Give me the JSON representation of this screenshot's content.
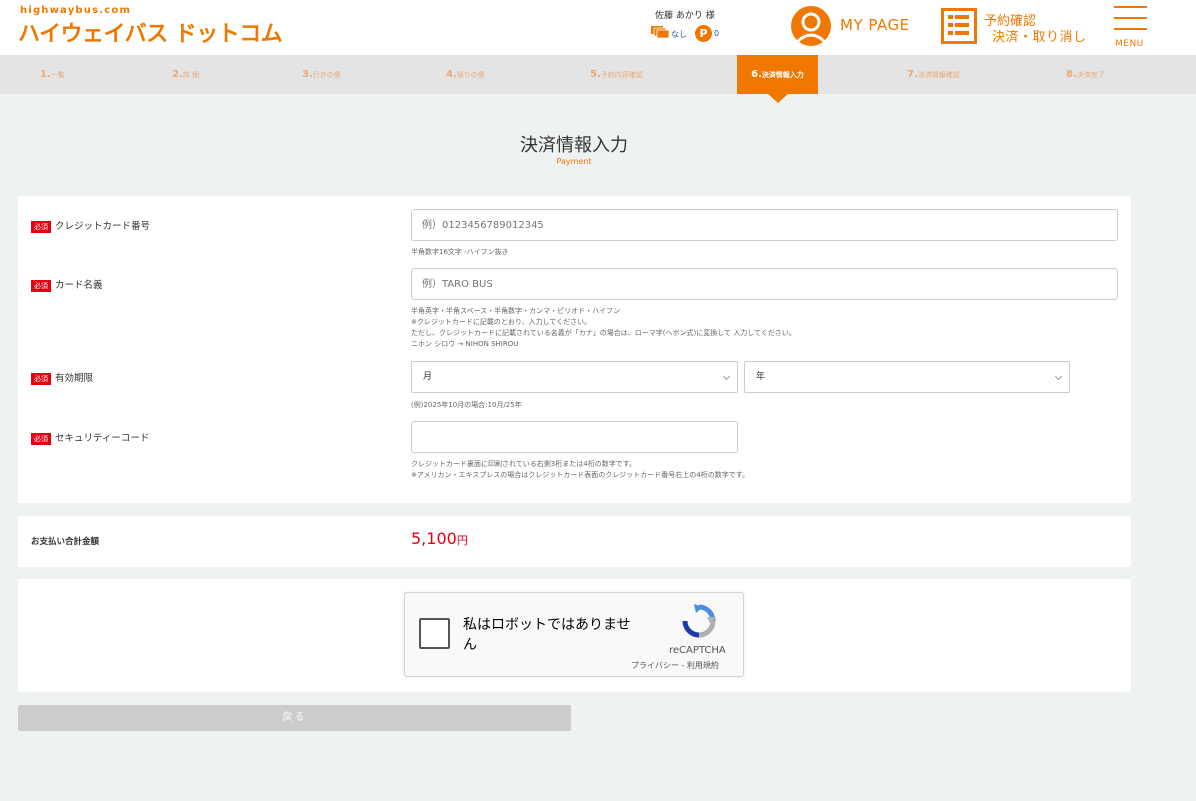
{
  "header": {
    "logo_small": "highwaybus.com",
    "logo_main": "ハイウェイバス ドットコム",
    "user_name": "佐藤 あかり 様",
    "coupon_text": "なし",
    "point_badge": "P",
    "point_value": "0",
    "mypage_label": "MY PAGE",
    "reservation_line1": "予約確認",
    "reservation_line2": "決済・取り消し",
    "menu_label": "MENU"
  },
  "steps": [
    {
      "num": "1.",
      "label": "一覧"
    },
    {
      "num": "2.",
      "label": "詳 細"
    },
    {
      "num": "3.",
      "label": "行きの便"
    },
    {
      "num": "4.",
      "label": "帰りの便"
    },
    {
      "num": "5.",
      "label": "予約内容確認"
    },
    {
      "num": "6.",
      "label": "決済情報入力"
    },
    {
      "num": "7.",
      "label": "決済情報確認"
    },
    {
      "num": "8.",
      "label": "決済完了"
    }
  ],
  "active_step": 6,
  "page": {
    "title": "決済情報入力",
    "subtitle": "Payment"
  },
  "form": {
    "required_badge": "必須",
    "card_number": {
      "label": "クレジットカード番号",
      "placeholder": "例）0123456789012345",
      "note": "半角数字16文字 -ハイフン抜き"
    },
    "card_name": {
      "label": "カード名義",
      "placeholder": "例）TARO BUS",
      "notes": [
        "半角英字・半角スペース・半角数字・カンマ・ピリオド・ハイフン",
        "※クレジットカードに記載のとおり、入力してください。",
        "ただし、クレジットカードに記載されている名義が「カナ」の場合は、ローマ字(ヘボン式)に変換して 入力してください。",
        "ニホン シロウ → NIHON SHIROU"
      ]
    },
    "expiry": {
      "label": "有効期限",
      "month_value": "月",
      "year_value": "年",
      "note": "(例)2025年10月の場合:10月/25年"
    },
    "security_code": {
      "label": "セキュリティーコード",
      "value": "",
      "notes": [
        "クレジットカード裏面に印刷されている右側3桁または4桁の数字です。",
        "※アメリカン・エキスプレスの場合はクレジットカード表面のクレジットカード番号右上の4桁の数字です。"
      ]
    }
  },
  "total": {
    "label": "お支払い合計金額",
    "amount": "5,100",
    "unit": "円"
  },
  "captcha": {
    "text": "私はロボットではありません",
    "brand": "reCAPTCHA",
    "privacy": "プライバシー",
    "separator": "-",
    "terms": "利用規約"
  },
  "back_button": "戻る",
  "colors": {
    "accent": "#f07800",
    "required": "#e60012",
    "amount": "#e60012"
  }
}
